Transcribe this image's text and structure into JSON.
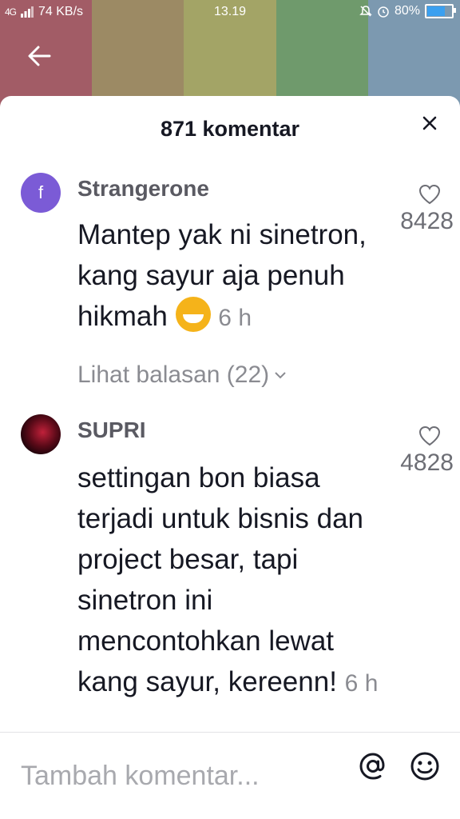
{
  "status_bar": {
    "network": "4G",
    "speed": "74 KB/s",
    "time": "13.19",
    "battery": "80%",
    "battery_level": 0.8
  },
  "background_colors": [
    "#a25c66",
    "#9c8a64",
    "#a3a466",
    "#6f9a6c",
    "#7c99b0"
  ],
  "header": {
    "title": "871 komentar",
    "back_icon": "arrow-left-icon",
    "close_icon": "close-icon"
  },
  "comments": [
    {
      "username": "Strangerone",
      "avatar_letter": "f",
      "text": "Mantep yak ni sinetron, kang sayur aja penuh hikmah",
      "emoji": "grinning-sweat-emoji",
      "time": "6 h",
      "likes": "8428",
      "replies": "Lihat balasan (22)"
    },
    {
      "username": "SUPRI",
      "text": "settingan bon biasa terjadi untuk bisnis dan project besar, tapi sinetron ini mencontohkan lewat kang sayur, kereenn!",
      "time": "6 h",
      "likes": "4828"
    }
  ],
  "input": {
    "placeholder": "Tambah komentar...",
    "value": ""
  },
  "icons": {
    "mention": "at-sign-icon",
    "emoji": "smiley-icon",
    "like": "heart-outline-icon"
  },
  "colors": {
    "avatar_purple": "#7b5bd6",
    "text_primary": "#161823",
    "text_secondary": "#8a8b91"
  }
}
